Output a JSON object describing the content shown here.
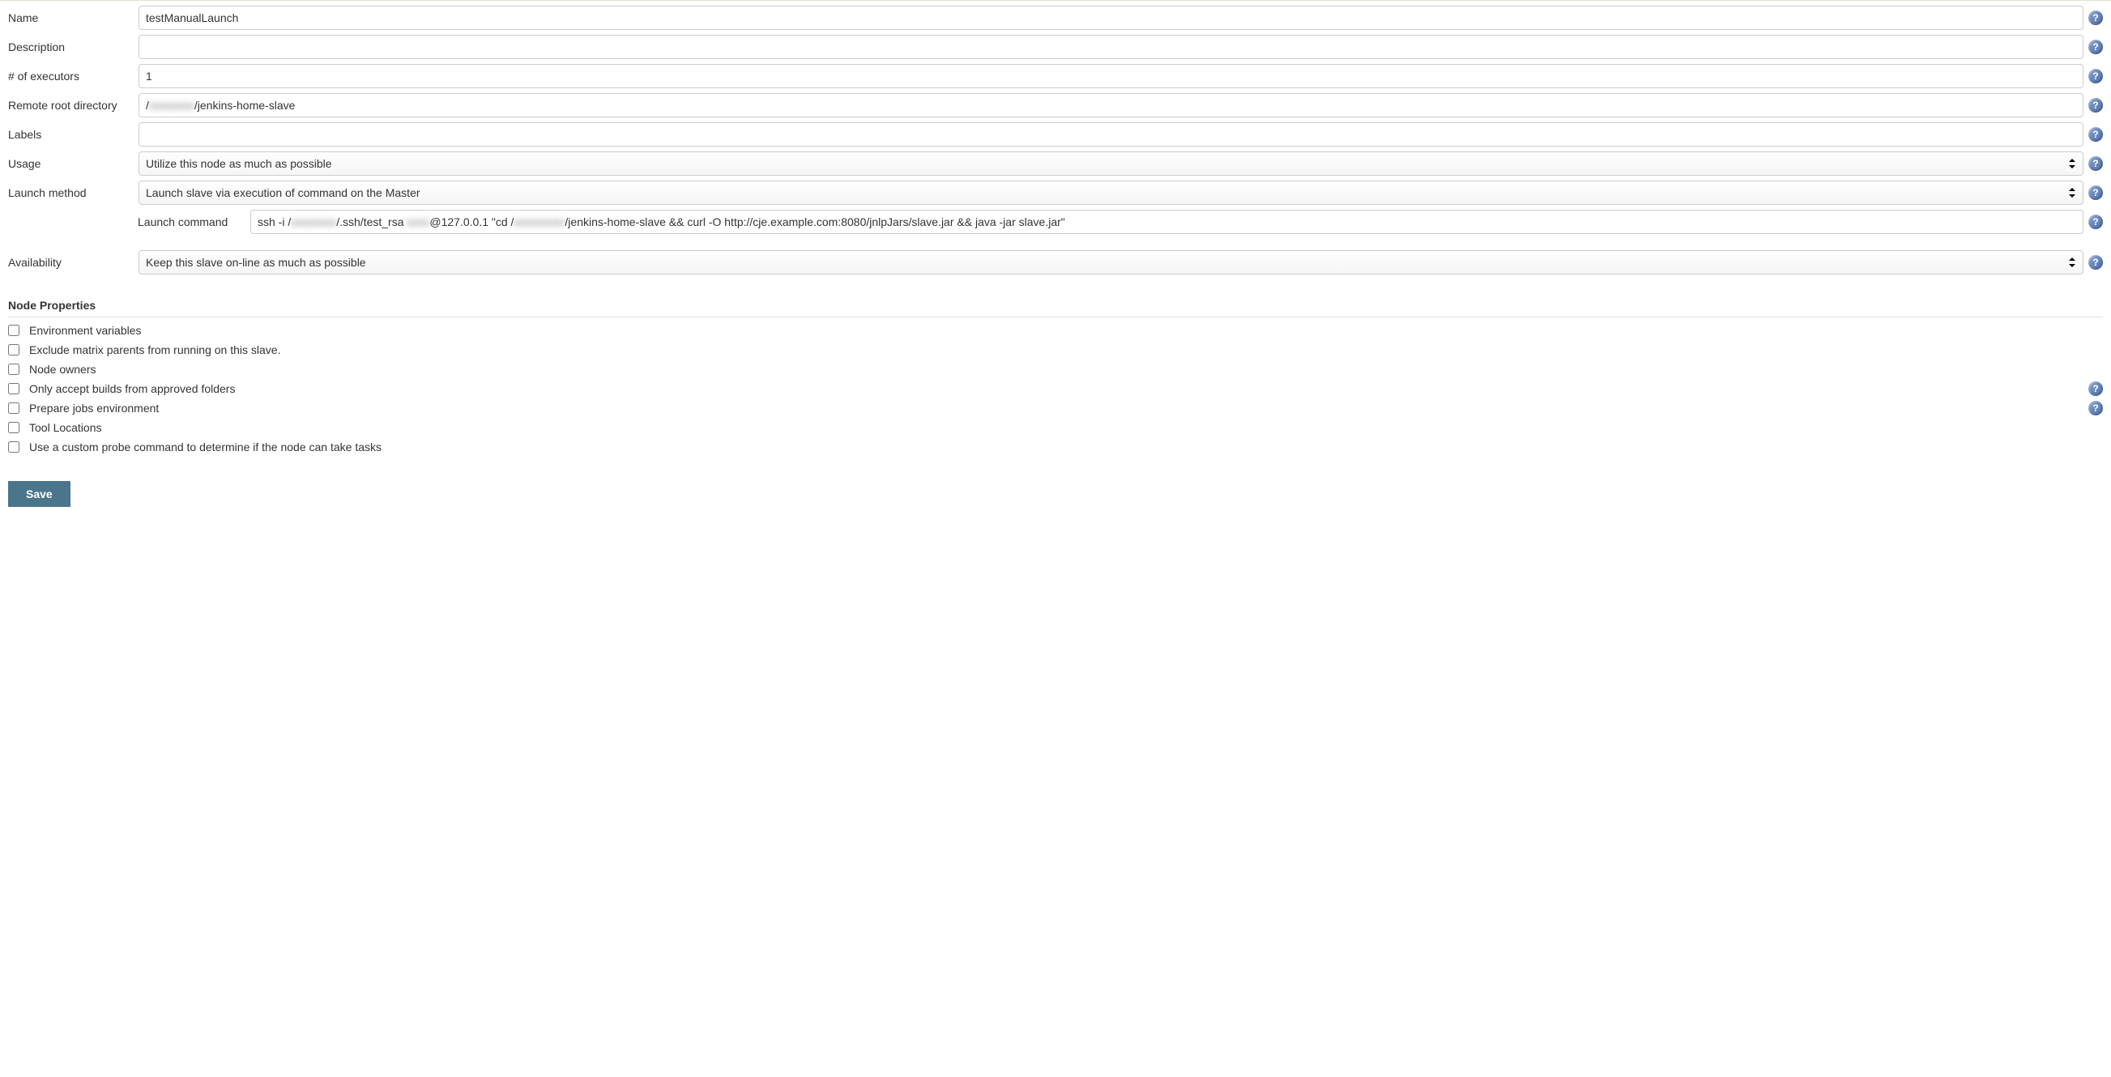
{
  "fields": {
    "name_label": "Name",
    "name_value": "testManualLaunch",
    "description_label": "Description",
    "description_value": "",
    "executors_label": "# of executors",
    "executors_value": "1",
    "remote_root_label": "Remote root directory",
    "remote_root_prefix": "/",
    "remote_root_blur": "xxxxxxxx",
    "remote_root_suffix": "/jenkins-home-slave",
    "labels_label": "Labels",
    "labels_value": "",
    "usage_label": "Usage",
    "usage_value": "Utilize this node as much as possible",
    "launch_method_label": "Launch method",
    "launch_method_value": "Launch slave via execution of command on the Master",
    "launch_command_label": "Launch command",
    "launch_command_p1": "ssh -i /",
    "launch_command_blur1": "xxxxxxxx",
    "launch_command_p2": "/.ssh/test_rsa ",
    "launch_command_blur2": "xxxx",
    "launch_command_p3": "@127.0.0.1 \"cd /",
    "launch_command_blur3": "xxxxxxxxx",
    "launch_command_p4": "/jenkins-home-slave && curl -O http://cje.example.com:8080/jnlpJars/slave.jar && java -jar slave.jar\"",
    "availability_label": "Availability",
    "availability_value": "Keep this slave on-line as much as possible"
  },
  "node_properties": {
    "header": "Node Properties",
    "items": [
      {
        "label": "Environment variables",
        "help": false
      },
      {
        "label": "Exclude matrix parents from running on this slave.",
        "help": false
      },
      {
        "label": "Node owners",
        "help": false
      },
      {
        "label": "Only accept builds from approved folders",
        "help": true
      },
      {
        "label": "Prepare jobs environment",
        "help": true
      },
      {
        "label": "Tool Locations",
        "help": false
      },
      {
        "label": "Use a custom probe command to determine if the node can take tasks",
        "help": false
      }
    ]
  },
  "buttons": {
    "save_label": "Save"
  }
}
